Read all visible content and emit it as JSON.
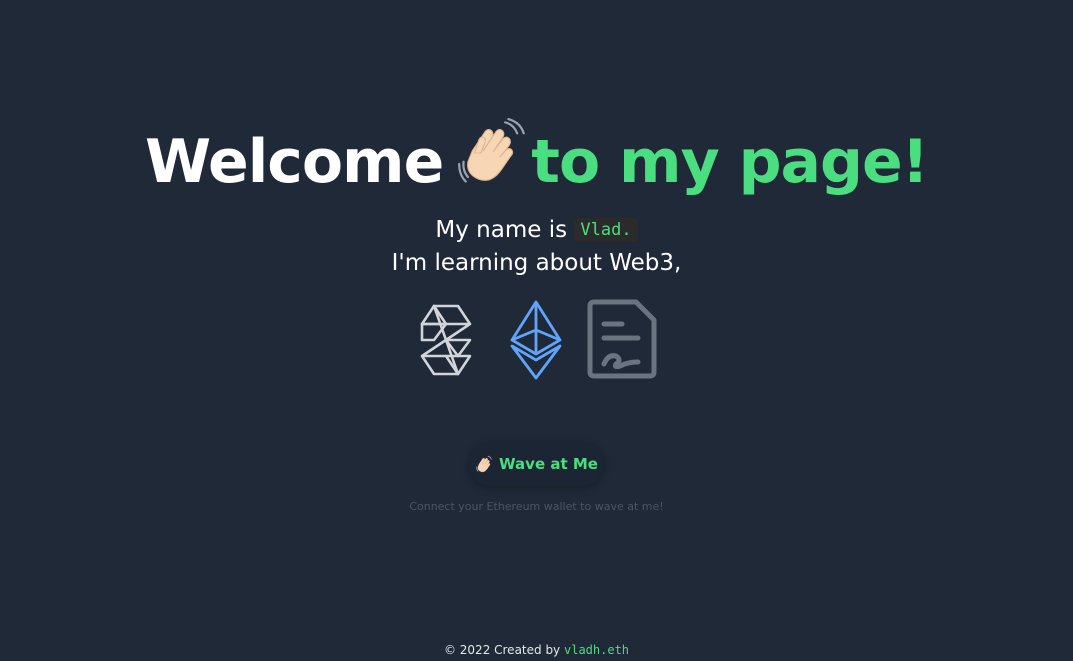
{
  "hero": {
    "title_white": "Welcome",
    "title_green": "to my page!",
    "wave_emoji": "waving-hand-icon"
  },
  "intro": {
    "name_prefix": "My name is",
    "name": "Vlad.",
    "learning": "I'm learning about Web3,"
  },
  "tech_icons": [
    {
      "name": "solidity-logo-icon",
      "color": "#d1d5db"
    },
    {
      "name": "ethereum-logo-icon",
      "color": "#60a5fa"
    },
    {
      "name": "contract-document-icon",
      "color": "#6b7280"
    }
  ],
  "wave_button": {
    "label": "Wave at Me",
    "icon": "waving-hand-icon"
  },
  "hint": "Connect your Ethereum wallet to wave at me!",
  "footer": {
    "prefix": "© 2022 Created by",
    "handle": "vladh.eth"
  },
  "colors": {
    "background": "#1f2937",
    "accent": "#4ade80",
    "text": "#ffffff"
  }
}
